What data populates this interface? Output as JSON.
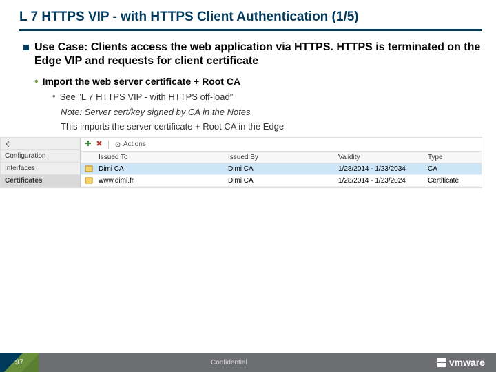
{
  "title": "L 7 HTTPS VIP - with HTTPS Client Authentication (1/5)",
  "usecase": "Use Case: Clients access the web application via HTTPS. HTTPS is terminated on the Edge VIP and requests for client certificate",
  "b2": "Import the web server certificate + Root CA",
  "b3": "See \"L 7 HTTPS VIP - with HTTPS off-load\"",
  "note1": "Note: Server cert/key signed by CA in the Notes",
  "note2": "This imports the server certificate + Root CA in the Edge",
  "side": {
    "top": "",
    "conf": "Configuration",
    "iface": "Interfaces",
    "cert": "Certificates"
  },
  "toolbar": {
    "actions": "Actions"
  },
  "headers": {
    "to": "Issued To",
    "by": "Issued By",
    "val": "Validity",
    "type": "Type"
  },
  "rows": [
    {
      "to": "Dimi CA",
      "by": "Dimi CA",
      "val": "1/28/2014 - 1/23/2034",
      "type": "CA"
    },
    {
      "to": "www.dimi.fr",
      "by": "Dimi CA",
      "val": "1/28/2014 - 1/23/2024",
      "type": "Certificate"
    }
  ],
  "footer": {
    "page": "97",
    "conf": "Confidential",
    "logo": "vmware"
  }
}
